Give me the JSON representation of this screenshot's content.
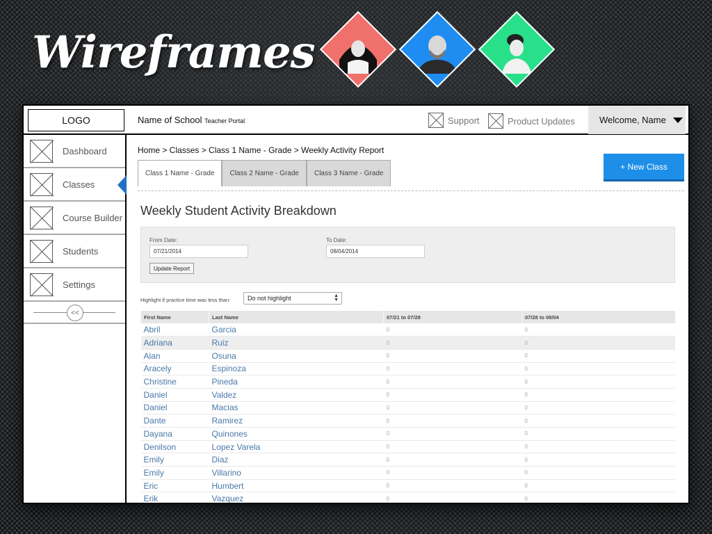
{
  "slide": {
    "title": "Wireframes"
  },
  "header": {
    "logo": "LOGO",
    "school_name": "Name of School",
    "portal_name": "Teacher Portal",
    "support": "Support",
    "product_updates": "Product Updates",
    "welcome": "Welcome, Name"
  },
  "sidebar": {
    "items": [
      {
        "label": "Dashboard",
        "active": false
      },
      {
        "label": "Classes",
        "active": true
      },
      {
        "label": "Course Builder",
        "active": false
      },
      {
        "label": "Students",
        "active": false
      },
      {
        "label": "Settings",
        "active": false
      }
    ],
    "collapse": "<<",
    "active_color": "#1f6fc6"
  },
  "main": {
    "breadcrumb": "Home > Classes > Class 1 Name - Grade > Weekly Activity Report",
    "tabs": [
      "Class 1 Name - Grade",
      "Class 2 Name - Grade",
      "Class 3 Name - Grade"
    ],
    "active_tab": 0,
    "new_class_button": "+ New Class",
    "section_title": "Weekly Student Activity Breakdown",
    "filters": {
      "from_label": "From Date:",
      "from_value": "07/21/2014",
      "to_label": "To Date:",
      "to_value": "08/04/2014",
      "update_button": "Update Report"
    },
    "highlight": {
      "label": "Highlight if practice time was less than:",
      "selected": "Do not highlight"
    },
    "table": {
      "columns": [
        "First Name",
        "Last Name",
        "07/21 to 07/28",
        "07/28 to 08/04"
      ],
      "rows": [
        [
          "Abril",
          "Garcia",
          "0",
          "0"
        ],
        [
          "Adriana",
          "Ruiz",
          "0",
          "0"
        ],
        [
          "Alan",
          "Osuna",
          "0",
          "0"
        ],
        [
          "Aracely",
          "Espinoza",
          "0",
          "0"
        ],
        [
          "Christine",
          "Pineda",
          "0",
          "0"
        ],
        [
          "Daniel",
          "Valdez",
          "0",
          "0"
        ],
        [
          "Daniel",
          "Macias",
          "0",
          "0"
        ],
        [
          "Dante",
          "Ramirez",
          "0",
          "0"
        ],
        [
          "Dayana",
          "Quinones",
          "0",
          "0"
        ],
        [
          "Denilson",
          "Lopez Varela",
          "0",
          "0"
        ],
        [
          "Emily",
          "Diaz",
          "0",
          "0"
        ],
        [
          "Emily",
          "Villarino",
          "0",
          "0"
        ],
        [
          "Eric",
          "Humbert",
          "0",
          "0"
        ],
        [
          "Erik",
          "Vazquez",
          "0",
          "0"
        ]
      ],
      "highlighted_row": 1
    }
  },
  "colors": {
    "accent": "#1e8fe8",
    "diamond_left": "#f0706c",
    "diamond_middle": "#1e8cf0",
    "diamond_right": "#29e08a"
  },
  "icons": [
    "placeholder-x-icon",
    "caret-down-icon",
    "portrait-icon"
  ]
}
